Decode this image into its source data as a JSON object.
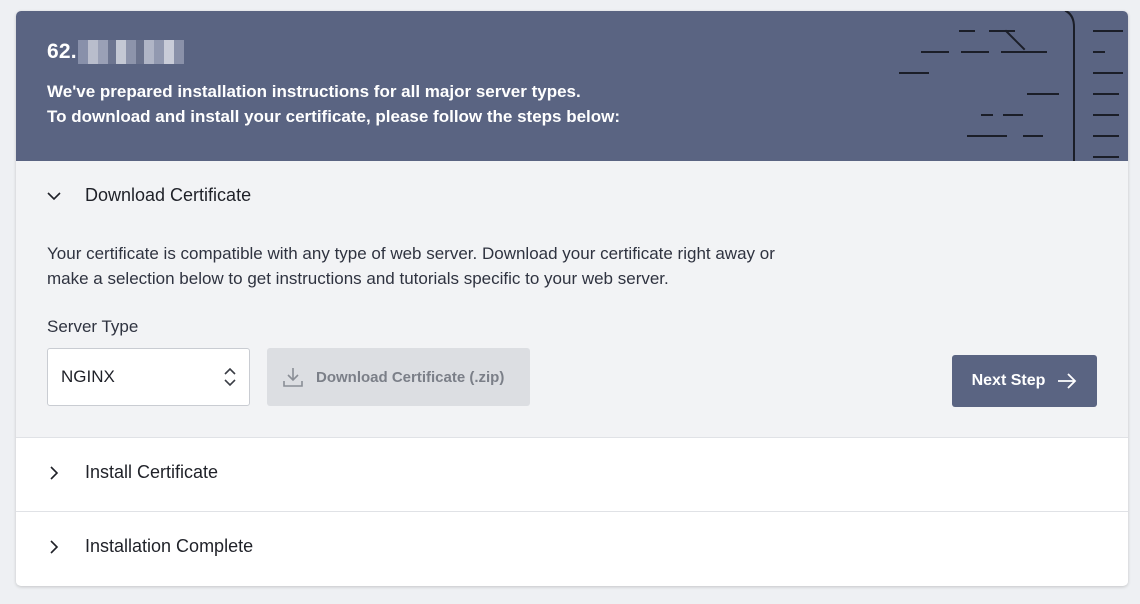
{
  "header": {
    "ip_prefix": "62.",
    "line1": "We've prepared installation instructions for all major server types.",
    "line2": "To download and install your certificate, please follow the steps below:"
  },
  "steps": [
    {
      "title": "Download Certificate",
      "state": "expanded",
      "description": "Your certificate is compatible with any type of web server. Download your certificate right away or make a selection below to get instructions and tutorials specific to your web server.",
      "server_type_label": "Server Type",
      "server_type_value": "NGINX",
      "download_label": "Download Certificate (.zip)",
      "next_label": "Next Step"
    },
    {
      "title": "Install Certificate",
      "state": "collapsed"
    },
    {
      "title": "Installation Complete",
      "state": "collapsed"
    }
  ],
  "colors": {
    "header_bg": "#5a6482",
    "accent_button": "#5a6482",
    "open_section_bg": "#f2f3f5",
    "disabled_button_bg": "#dcdee2"
  },
  "icons": [
    "chevron-down-icon",
    "chevron-right-icon",
    "updown-icon",
    "download-icon",
    "arrow-right-icon"
  ]
}
